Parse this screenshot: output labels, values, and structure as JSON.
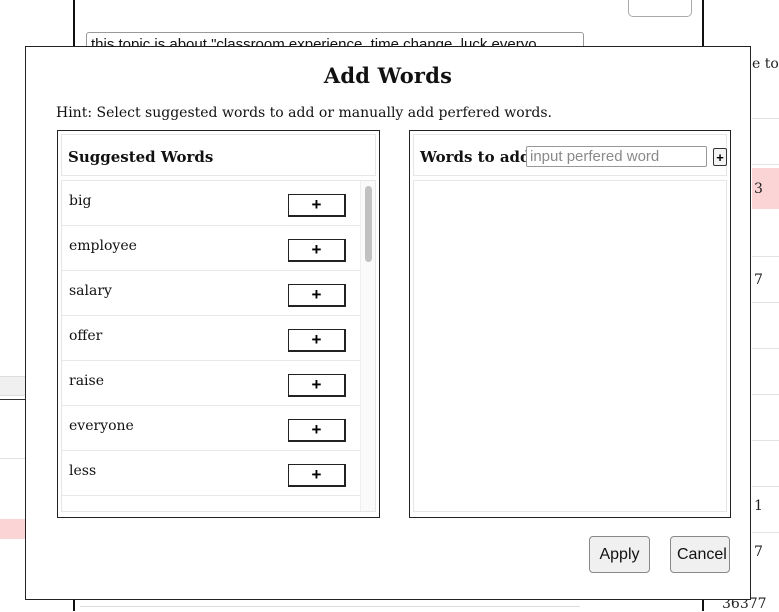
{
  "background": {
    "topic_text": "this topic is about \"classroom experience, time change, luck everyo",
    "edge_texts": [
      "e to",
      "3",
      "7",
      "1",
      "7",
      "36377"
    ]
  },
  "modal": {
    "title": "Add Words",
    "hint": "Hint: Select suggested words to add or manually add perfered words.",
    "suggested": {
      "header": "Suggested Words",
      "add_button_label": "+",
      "words": [
        "big",
        "employee",
        "salary",
        "offer",
        "raise",
        "everyone",
        "less"
      ]
    },
    "to_add": {
      "header": "Words to add",
      "input_placeholder": "input perfered word",
      "input_value": "",
      "add_button_label": "+",
      "words": []
    },
    "apply_label": "Apply",
    "cancel_label": "Cancel"
  }
}
